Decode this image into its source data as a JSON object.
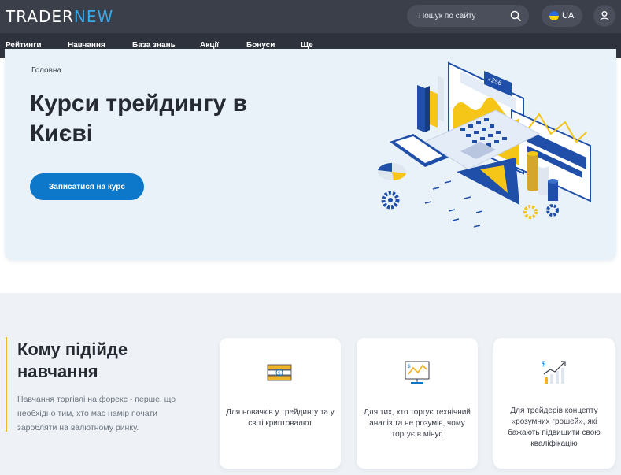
{
  "header": {
    "logo_part1": "TRADER",
    "logo_part2": "NEW",
    "search_placeholder": "Пошук по сайту",
    "language": "UA"
  },
  "nav": {
    "items": [
      "Рейтинги",
      "Навчання",
      "База знань",
      "Акції",
      "Бонуси",
      "Ще"
    ]
  },
  "hero": {
    "breadcrumb": "Головна",
    "title": "Курси трейдингу в Києві",
    "cta_label": "Записатися на курс",
    "illustration_label": "+256"
  },
  "audience": {
    "title": "Кому підійде навчання",
    "text": "Навчання торгівлі на форекс - перше, що необхідно тим, хто має намір почати заробляти на валютному ринку.",
    "cards": [
      {
        "icon": "money-stack-icon",
        "text": "Для новачків у трейдингу та у світі криптовалют"
      },
      {
        "icon": "monitor-chart-icon",
        "text": "Для тих, хто торгує технічний аналіз та не розуміє, чому торгує в мінус"
      },
      {
        "icon": "growth-chart-icon",
        "text": "Для трейдерів концепту «розумних грошей», які бажають підвищити свою кваліфікацію"
      }
    ]
  },
  "colors": {
    "topbar": "#3b3f4a",
    "nav": "#2e323c",
    "accent_blue": "#0d78c9",
    "accent_yellow": "#f0b429"
  }
}
